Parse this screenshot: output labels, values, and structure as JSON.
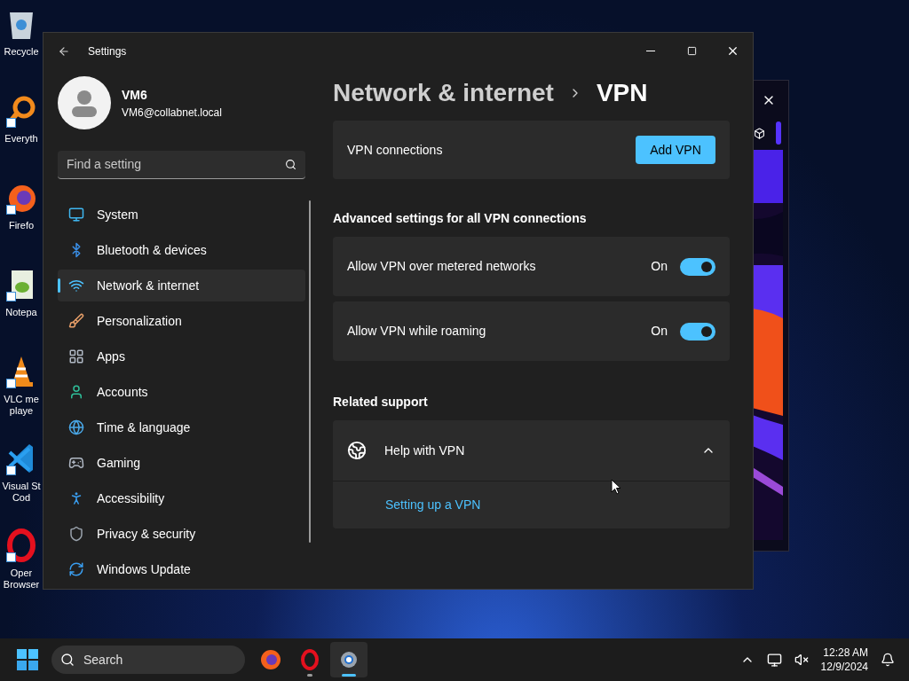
{
  "desktop_icons": [
    {
      "label": "Recycle"
    },
    {
      "label": "Everyth"
    },
    {
      "label": "Firefo"
    },
    {
      "label": "Notepa"
    },
    {
      "label": "VLC me playe"
    },
    {
      "label": "Visual St Cod"
    },
    {
      "label": "Oper Browser"
    }
  ],
  "settings": {
    "window_title": "Settings",
    "user": {
      "name": "VM6",
      "email": "VM6@collabnet.local"
    },
    "search": {
      "placeholder": "Find a setting"
    },
    "nav_items": [
      {
        "label": "System",
        "selected": false
      },
      {
        "label": "Bluetooth & devices",
        "selected": false
      },
      {
        "label": "Network & internet",
        "selected": true
      },
      {
        "label": "Personalization",
        "selected": false
      },
      {
        "label": "Apps",
        "selected": false
      },
      {
        "label": "Accounts",
        "selected": false
      },
      {
        "label": "Time & language",
        "selected": false
      },
      {
        "label": "Gaming",
        "selected": false
      },
      {
        "label": "Accessibility",
        "selected": false
      },
      {
        "label": "Privacy & security",
        "selected": false
      },
      {
        "label": "Windows Update",
        "selected": false
      }
    ],
    "breadcrumb": [
      "Network & internet",
      "VPN"
    ],
    "vpn_connections": {
      "label": "VPN connections",
      "button": "Add VPN"
    },
    "advanced_heading": "Advanced settings for all VPN connections",
    "toggles": [
      {
        "label": "Allow VPN over metered networks",
        "state_text": "On",
        "on": true
      },
      {
        "label": "Allow VPN while roaming",
        "state_text": "On",
        "on": true
      }
    ],
    "related_heading": "Related support",
    "help": {
      "title": "Help with VPN",
      "expanded": true,
      "links": [
        "Setting up a VPN"
      ]
    }
  },
  "taskbar": {
    "search_placeholder": "Search",
    "apps": [
      {
        "running": false,
        "active": false
      },
      {
        "running": true,
        "active": false
      },
      {
        "running": true,
        "active": true
      }
    ],
    "time": "12:28 AM",
    "date": "12/9/2024"
  }
}
